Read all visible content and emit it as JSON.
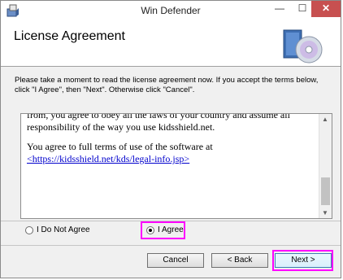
{
  "window": {
    "title": "Win Defender",
    "minimize_glyph": "—",
    "maximize_glyph": "☐",
    "close_glyph": "✕"
  },
  "header": {
    "title": "License Agreement"
  },
  "instructions": "Please take a moment to read the license agreement now. If you accept the terms below, click \"I Agree\", then \"Next\". Otherwise click \"Cancel\".",
  "license": {
    "paragraph1": "from, you agree to obey all the laws of your country and assume all responsibility of the way you use kidsshield.net.",
    "paragraph2": "You agree to full terms of use of the software at",
    "link": "<https://kidsshield.net/kds/legal-info.jsp>"
  },
  "options": {
    "disagree": "I Do Not Agree",
    "agree": "I Agree",
    "selected": "agree"
  },
  "buttons": {
    "cancel": "Cancel",
    "back": "< Back",
    "next": "Next >"
  },
  "colors": {
    "highlight": "#ff00ff",
    "close_button": "#c75050"
  },
  "icons": [
    "installer-app-icon",
    "cd-install-icon"
  ]
}
